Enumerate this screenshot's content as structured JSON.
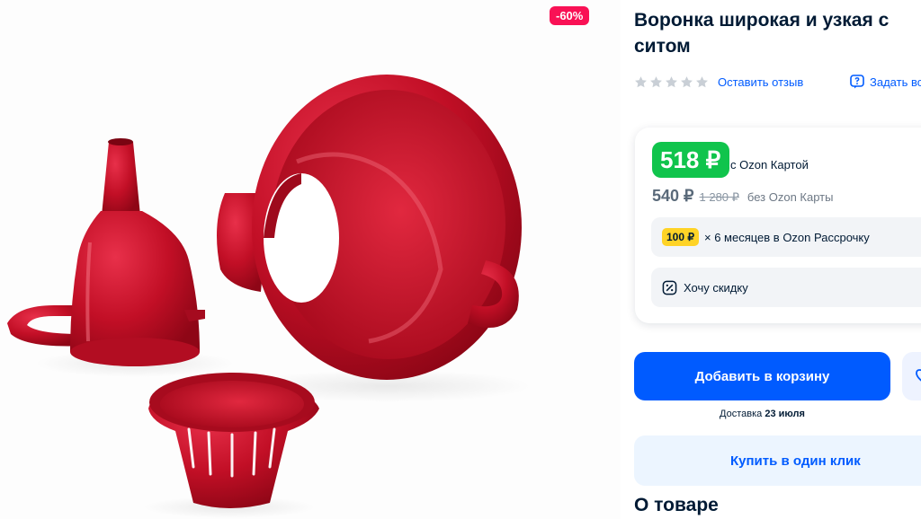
{
  "product": {
    "title": "Воронка широкая и узкая с ситом",
    "discount_badge": "-60%",
    "image_alt": "Red funnels with strainer"
  },
  "rating": {
    "stars_filled": 0,
    "stars_total": 5,
    "review_link": "Оставить отзыв",
    "question_link": "Задать вопрос"
  },
  "pricing": {
    "ozon_price": "518 ₽",
    "ozon_price_label": "с Ozon Картой",
    "regular_price": "540 ₽",
    "old_price": "1 280 ₽",
    "regular_label": "без Ozon Карты",
    "installment_badge": "100 ₽",
    "installment_text": "× 6 месяцев в Ozon Рассрочку",
    "want_discount": "Хочу скидку"
  },
  "actions": {
    "add_to_cart": "Добавить в корзину",
    "delivery_prefix": "Доставка",
    "delivery_date": "23 июля",
    "buy_one_click": "Купить в один клик"
  },
  "sections": {
    "about": "О товаре"
  },
  "colors": {
    "brand_blue": "#005bff",
    "discount_pink": "#f91155",
    "ozon_green": "#10c44c",
    "installment_yellow": "#ffd326",
    "product_red": "#c8102e"
  },
  "icons": {
    "star": "star-icon",
    "question": "question-icon",
    "discount": "discount-icon",
    "favorite": "heart-icon"
  }
}
